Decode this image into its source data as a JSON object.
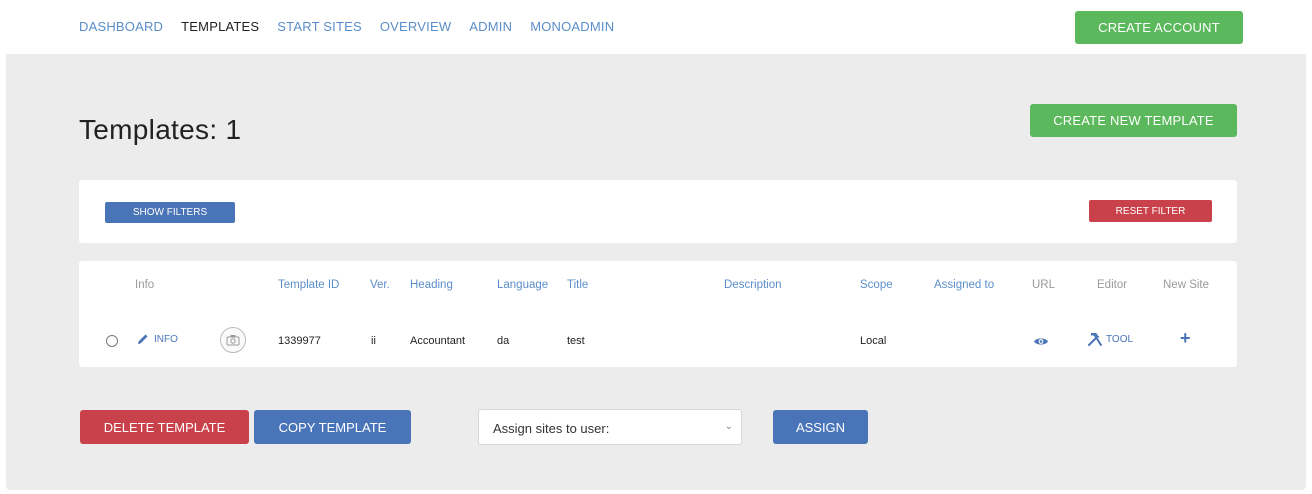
{
  "nav": {
    "items": [
      {
        "label": "DASHBOARD",
        "active": false
      },
      {
        "label": "TEMPLATES",
        "active": true
      },
      {
        "label": "START SITES",
        "active": false
      },
      {
        "label": "OVERVIEW",
        "active": false
      },
      {
        "label": "ADMIN",
        "active": false
      },
      {
        "label": "MONOADMIN",
        "active": false
      }
    ],
    "create_account_label": "CREATE ACCOUNT"
  },
  "page": {
    "title": "Templates: 1",
    "create_template_label": "CREATE NEW TEMPLATE"
  },
  "filters": {
    "show_label": "SHOW FILTERS",
    "reset_label": "RESET FILTER"
  },
  "table": {
    "headers": {
      "info": "Info",
      "template_id": "Template ID",
      "version": "Ver.",
      "heading": "Heading",
      "language": "Language",
      "title": "Title",
      "description": "Description",
      "scope": "Scope",
      "assigned_to": "Assigned to",
      "url": "URL",
      "editor": "Editor",
      "new_site": "New Site"
    },
    "rows": [
      {
        "info_label": "INFO",
        "template_id": "1339977",
        "version": "ii",
        "heading": "Accountant",
        "language": "da",
        "title": "test",
        "description": "",
        "scope": "Local",
        "assigned_to": "",
        "editor_label": "TOOL",
        "new_site": "+"
      }
    ]
  },
  "actions": {
    "delete_label": "DELETE TEMPLATE",
    "copy_label": "COPY TEMPLATE",
    "assign_select_value": "Assign sites to user:",
    "assign_label": "ASSIGN"
  },
  "colors": {
    "green": "#5cb85c",
    "blue": "#4a74b8",
    "red": "#c9414a",
    "link": "#5b8ec9"
  }
}
